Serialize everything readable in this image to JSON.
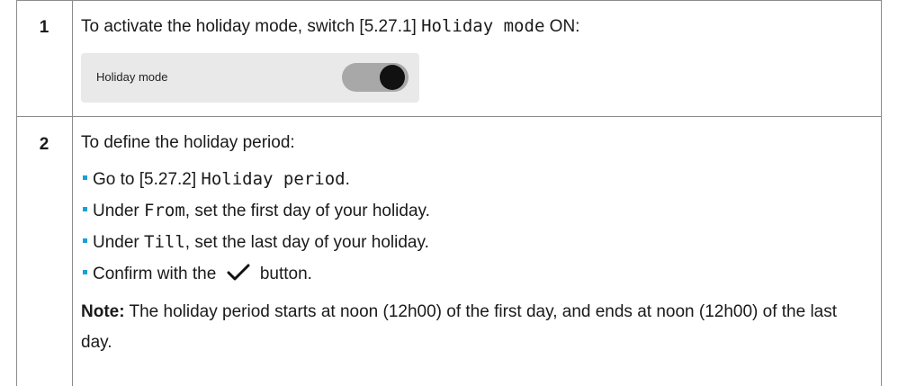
{
  "steps": [
    {
      "number": "1",
      "text_before": "To activate the holiday mode, switch [5.27.1] ",
      "code": "Holiday mode",
      "text_after": " ON:",
      "panel": {
        "label": "Holiday mode",
        "toggle_state": "on"
      }
    },
    {
      "number": "2",
      "intro": "To define the holiday period:",
      "bullets": [
        {
          "before": "Go to [5.27.2] ",
          "code": "Holiday period",
          "after": "."
        },
        {
          "before": "Under ",
          "code": "From",
          "after": ", set the first day of your holiday."
        },
        {
          "before": "Under ",
          "code": "Till",
          "after": ", set the last day of your holiday."
        },
        {
          "before": "Confirm with the ",
          "icon": "checkmark-icon",
          "after": " button."
        }
      ],
      "note_label": "Note:",
      "note_text": " The holiday period starts at noon (12h00) of the first day, and ends at noon (12h00) of the last day."
    }
  ],
  "colors": {
    "bullet": "#1aa0d8",
    "toggle_track": "#a8a8a8",
    "toggle_knob": "#111111",
    "panel_bg": "#e9e9e9"
  }
}
